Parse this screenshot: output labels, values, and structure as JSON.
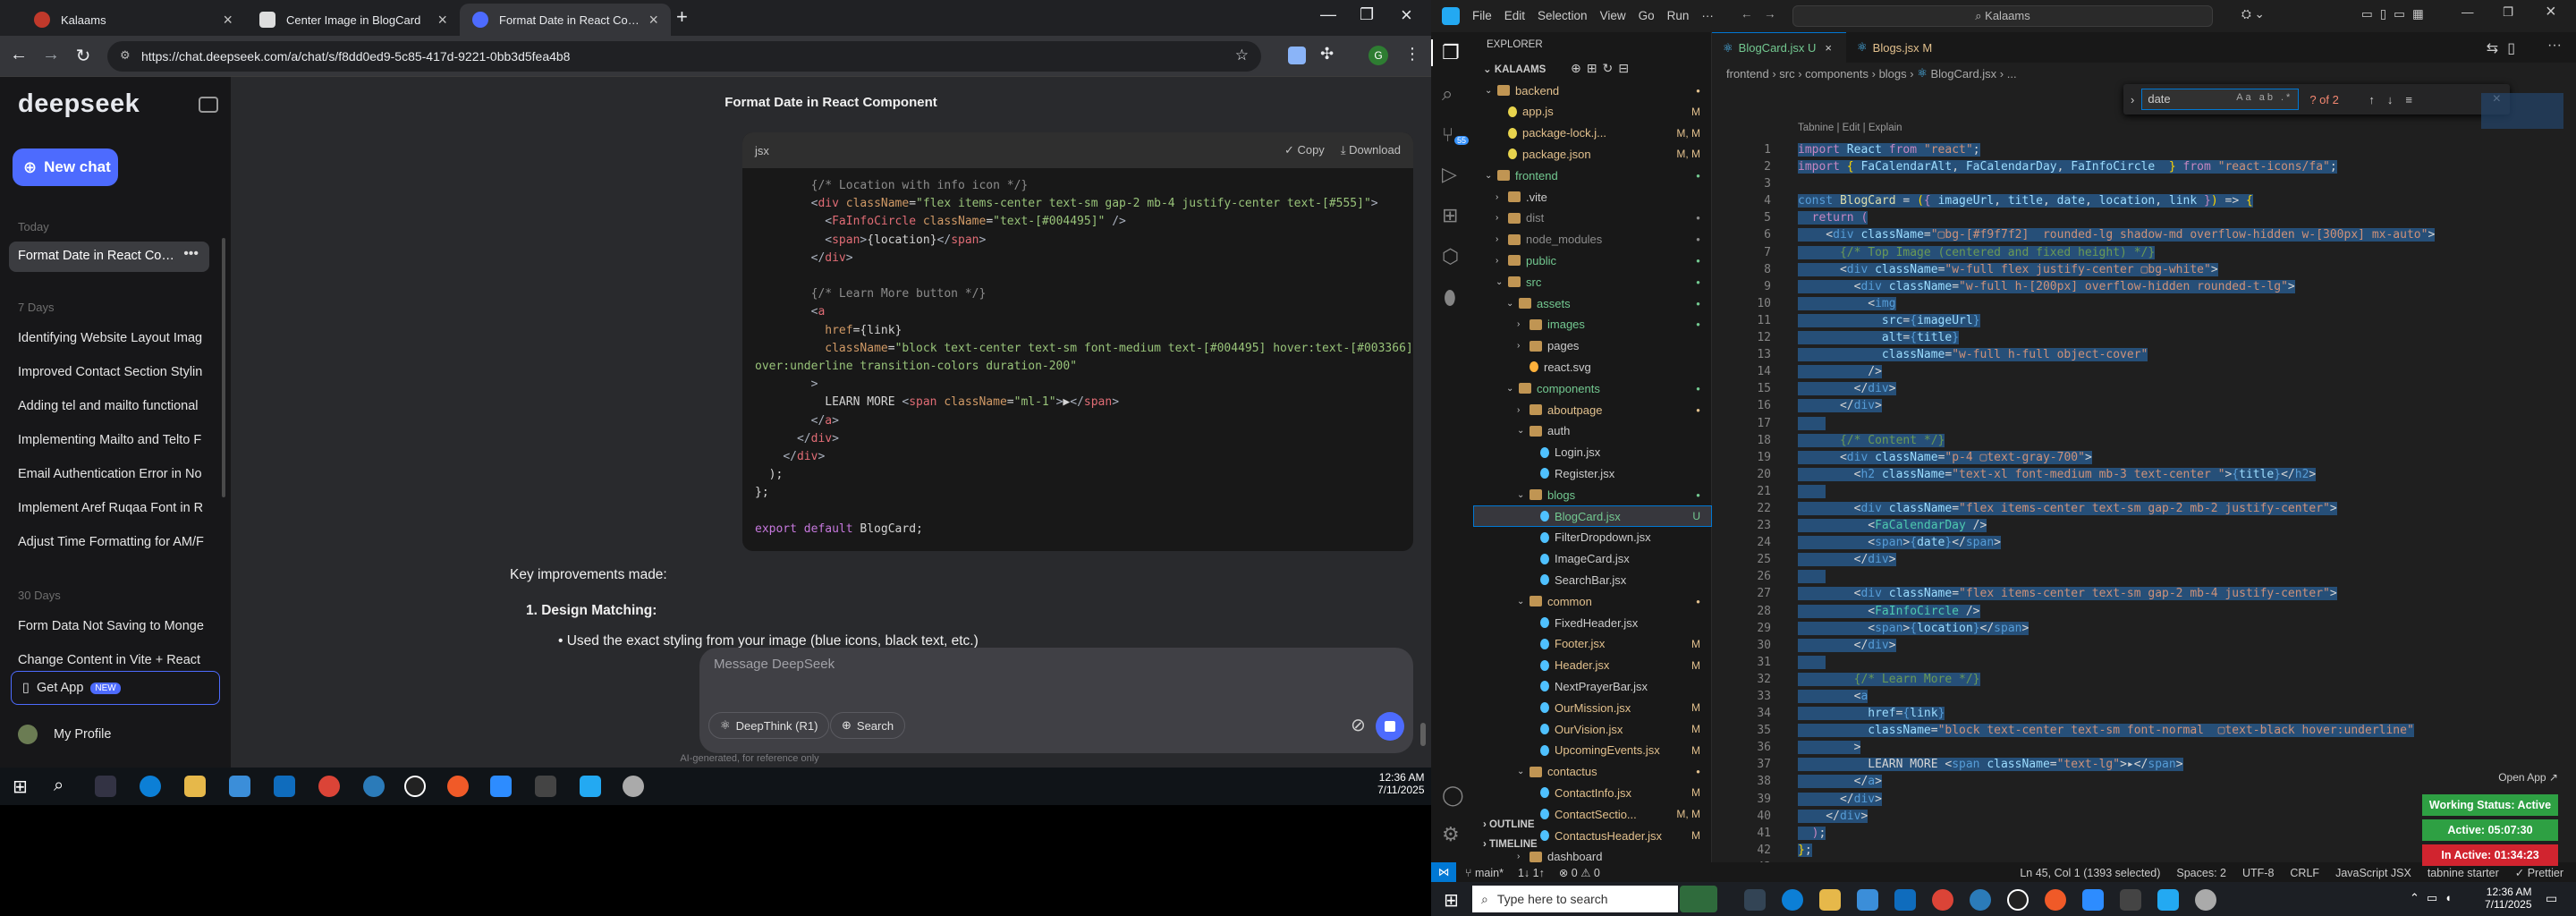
{
  "browser": {
    "tabs": [
      {
        "title": "Kalaams",
        "color": "#c0392b"
      },
      {
        "title": "Center Image in BlogCard",
        "color": "#dddddd"
      },
      {
        "title": "Format Date in React Compone",
        "color": "#4d6bfe"
      }
    ],
    "url": "https://chat.deepseek.com/a/chat/s/f8dd0ed9-5c85-417d-9221-0bb3d5fea4b8"
  },
  "deepseek": {
    "logo": "deepseek",
    "new_chat": "New chat",
    "sections": {
      "today": "Today",
      "days7": "7 Days",
      "days30": "30 Days"
    },
    "today_items": [
      "Format Date in React Comp"
    ],
    "week_items": [
      "Identifying Website Layout Imag",
      "Improved Contact Section Stylin",
      "Adding tel and mailto functional",
      "Implementing Mailto and Telto F",
      "Email Authentication Error in No",
      "Implement Aref Ruqaa Font in R",
      "Adjust Time Formatting for AM/F"
    ],
    "month_items": [
      "Form Data Not Saving to Monge",
      "Change Content in Vite + React"
    ],
    "get_app": "Get App",
    "new_badge": "NEW",
    "profile": "My Profile",
    "chat_title": "Format Date in React Component",
    "code_lang": "jsx",
    "copy": "Copy",
    "download": "Download",
    "improvements": "Key improvements made:",
    "point1": "1. Design Matching:",
    "subpoint": "Used the exact styling from your image (blue icons, black text, etc.)",
    "placeholder": "Message DeepSeek",
    "deepthink": "DeepThink (R1)",
    "search": "Search",
    "disclaimer": "AI-generated, for reference only"
  },
  "taskbar_left": {
    "time": "12:36 AM",
    "date": "7/11/2025"
  },
  "vscode": {
    "menu": [
      "File",
      "Edit",
      "Selection",
      "View",
      "Go",
      "Run",
      "···"
    ],
    "search": "Kalaams",
    "explorer_title": "EXPLORER",
    "root": "KALAAMS",
    "tree": [
      {
        "name": "backend",
        "indent": 1,
        "type": "folder-open",
        "color": "#e2c08d",
        "badge": "dot"
      },
      {
        "name": "app.js",
        "indent": 2,
        "type": "js",
        "color": "#e2c08d",
        "badge": "M"
      },
      {
        "name": "package-lock.j...",
        "indent": 2,
        "type": "json",
        "color": "#e2c08d",
        "badge": "M, M"
      },
      {
        "name": "package.json",
        "indent": 2,
        "type": "json",
        "color": "#e2c08d",
        "badge": "M, M"
      },
      {
        "name": "frontend",
        "indent": 1,
        "type": "folder-open",
        "color": "#73c991",
        "badge": "dot"
      },
      {
        "name": ".vite",
        "indent": 2,
        "type": "folder",
        "color": "#ccc",
        "badge": ""
      },
      {
        "name": "dist",
        "indent": 2,
        "type": "folder",
        "color": "#8c8c8c",
        "badge": "dot"
      },
      {
        "name": "node_modules",
        "indent": 2,
        "type": "folder",
        "color": "#8c8c8c",
        "badge": "dot"
      },
      {
        "name": "public",
        "indent": 2,
        "type": "folder",
        "color": "#73c991",
        "badge": "dot"
      },
      {
        "name": "src",
        "indent": 2,
        "type": "folder-open",
        "color": "#73c991",
        "badge": "dot"
      },
      {
        "name": "assets",
        "indent": 3,
        "type": "folder-open",
        "color": "#73c991",
        "badge": "dot"
      },
      {
        "name": "images",
        "indent": 4,
        "type": "folder",
        "color": "#73c991",
        "badge": "dot"
      },
      {
        "name": "pages",
        "indent": 4,
        "type": "folder",
        "color": "#ccc",
        "badge": ""
      },
      {
        "name": "react.svg",
        "indent": 4,
        "type": "svg",
        "color": "#ccc",
        "badge": ""
      },
      {
        "name": "components",
        "indent": 3,
        "type": "folder-open",
        "color": "#73c991",
        "badge": "dot"
      },
      {
        "name": "aboutpage",
        "indent": 4,
        "type": "folder",
        "color": "#e2c08d",
        "badge": "dot"
      },
      {
        "name": "auth",
        "indent": 4,
        "type": "folder-open",
        "color": "#ccc",
        "badge": ""
      },
      {
        "name": "Login.jsx",
        "indent": 5,
        "type": "jsx",
        "color": "#ccc",
        "badge": ""
      },
      {
        "name": "Register.jsx",
        "indent": 5,
        "type": "jsx",
        "color": "#ccc",
        "badge": ""
      },
      {
        "name": "blogs",
        "indent": 4,
        "type": "folder-open",
        "color": "#73c991",
        "badge": "dot"
      },
      {
        "name": "BlogCard.jsx",
        "indent": 5,
        "type": "jsx",
        "color": "#73c991",
        "badge": "U",
        "active": true
      },
      {
        "name": "FilterDropdown.jsx",
        "indent": 5,
        "type": "jsx",
        "color": "#ccc",
        "badge": ""
      },
      {
        "name": "ImageCard.jsx",
        "indent": 5,
        "type": "jsx",
        "color": "#ccc",
        "badge": ""
      },
      {
        "name": "SearchBar.jsx",
        "indent": 5,
        "type": "jsx",
        "color": "#ccc",
        "badge": ""
      },
      {
        "name": "common",
        "indent": 4,
        "type": "folder-open",
        "color": "#e2c08d",
        "badge": "dot"
      },
      {
        "name": "FixedHeader.jsx",
        "indent": 5,
        "type": "jsx",
        "color": "#ccc",
        "badge": ""
      },
      {
        "name": "Footer.jsx",
        "indent": 5,
        "type": "jsx",
        "color": "#e2c08d",
        "badge": "M"
      },
      {
        "name": "Header.jsx",
        "indent": 5,
        "type": "jsx",
        "color": "#e2c08d",
        "badge": "M"
      },
      {
        "name": "NextPrayerBar.jsx",
        "indent": 5,
        "type": "jsx",
        "color": "#ccc",
        "badge": ""
      },
      {
        "name": "OurMission.jsx",
        "indent": 5,
        "type": "jsx",
        "color": "#e2c08d",
        "badge": "M"
      },
      {
        "name": "OurVision.jsx",
        "indent": 5,
        "type": "jsx",
        "color": "#e2c08d",
        "badge": "M"
      },
      {
        "name": "UpcomingEvents.jsx",
        "indent": 5,
        "type": "jsx",
        "color": "#e2c08d",
        "badge": "M"
      },
      {
        "name": "contactus",
        "indent": 4,
        "type": "folder-open",
        "color": "#e2c08d",
        "badge": "dot"
      },
      {
        "name": "ContactInfo.jsx",
        "indent": 5,
        "type": "jsx",
        "color": "#e2c08d",
        "badge": "M"
      },
      {
        "name": "ContactSectio...",
        "indent": 5,
        "type": "jsx",
        "color": "#e2c08d",
        "badge": "M, M"
      },
      {
        "name": "ContactusHeader.jsx",
        "indent": 5,
        "type": "jsx",
        "color": "#e2c08d",
        "badge": "M"
      },
      {
        "name": "dashboard",
        "indent": 4,
        "type": "folder",
        "color": "#ccc",
        "badge": ""
      }
    ],
    "outline": "OUTLINE",
    "timeline": "TIMELINE",
    "editor_tabs": [
      {
        "name": "BlogCard.jsx",
        "badge": "U",
        "active": true
      },
      {
        "name": "Blogs.jsx",
        "badge": "M",
        "active": false
      }
    ],
    "breadcrumb": [
      "frontend",
      "src",
      "components",
      "blogs",
      "BlogCard.jsx",
      "..."
    ],
    "find_text": "date",
    "find_count": "? of 2",
    "codelens": "Tabnine | Edit | Explain",
    "status": {
      "branch": "main*",
      "sync": "1↓ 1↑",
      "problems": "⊗ 0 ⚠ 0",
      "position": "Ln 45, Col 1 (1393 selected)",
      "spaces": "Spaces: 2",
      "encoding": "UTF-8",
      "eol": "CRLF",
      "lang": "JavaScript JSX",
      "tabnine": "tabnine starter",
      "prettier": "✓ Prettier"
    },
    "working_status": {
      "open_app": "Open App ↗",
      "status": "Working Status: Active",
      "active": "Active: 05:07:30",
      "inactive": "In Active: 01:34:23",
      "status_color": "#2ea043",
      "inactive_color": "#d1242f"
    }
  },
  "taskbar_right": {
    "search_placeholder": "Type here to search",
    "time": "12:36 AM",
    "date": "7/11/2025"
  }
}
